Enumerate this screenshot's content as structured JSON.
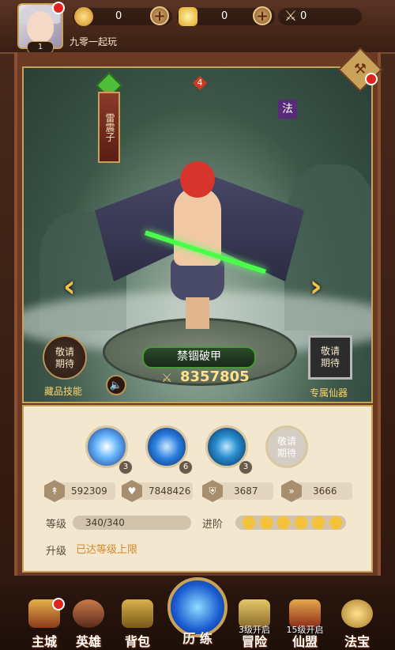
{
  "top_bar": {
    "level": "1",
    "nickname": "九零一起玩",
    "resources": [
      {
        "icon": "copper-coin-icon",
        "value": "0"
      },
      {
        "icon": "gold-ingot-icon",
        "value": "0"
      },
      {
        "icon": "crossed-swords-icon",
        "value": "0"
      }
    ]
  },
  "hero_scene": {
    "hero_name": "雷震子",
    "star_count": "4",
    "class_badge": "法",
    "skill_name": "禁锢破甲",
    "combat_power": "8357805",
    "collection_skill": {
      "button": "敬请\n期待",
      "label": "藏品技能"
    },
    "exclusive_artifact": {
      "button": "敬请\n期待",
      "label": "专属仙器"
    },
    "prev_arrow": "‹",
    "next_arrow": "›"
  },
  "skills": [
    {
      "name": "skill-1",
      "level": "3"
    },
    {
      "name": "skill-2",
      "level": "6"
    },
    {
      "name": "skill-3",
      "level": "3"
    },
    {
      "name": "skill-4-locked",
      "text": "敬请\n期待"
    }
  ],
  "stats": [
    {
      "icon": "attack-icon",
      "value": "592309"
    },
    {
      "icon": "hp-icon",
      "value": "7848426"
    },
    {
      "icon": "defense-icon",
      "value": "3687"
    },
    {
      "icon": "speed-icon",
      "value": "3666"
    }
  ],
  "level": {
    "label": "等级",
    "value": "340/340"
  },
  "advance": {
    "label": "进阶",
    "stars": 6
  },
  "upgrade": {
    "label": "升级",
    "message": "已达等级上限"
  },
  "nav": [
    {
      "label": "主城",
      "icon": "city-icon"
    },
    {
      "label": "英雄",
      "icon": "hero-icon"
    },
    {
      "label": "背包",
      "icon": "bag-icon"
    },
    {
      "label": "历 练",
      "icon": "portal-icon"
    },
    {
      "label": "冒险",
      "icon": "adventure-icon",
      "lock": "3级开启"
    },
    {
      "label": "仙盟",
      "icon": "guild-icon",
      "lock": "15级开启"
    },
    {
      "label": "法宝",
      "icon": "treasure-icon"
    }
  ],
  "colors": {
    "accent": "#c9a25a",
    "panel": "#f3e7cf",
    "upgrade_msg": "#d48a2a"
  }
}
